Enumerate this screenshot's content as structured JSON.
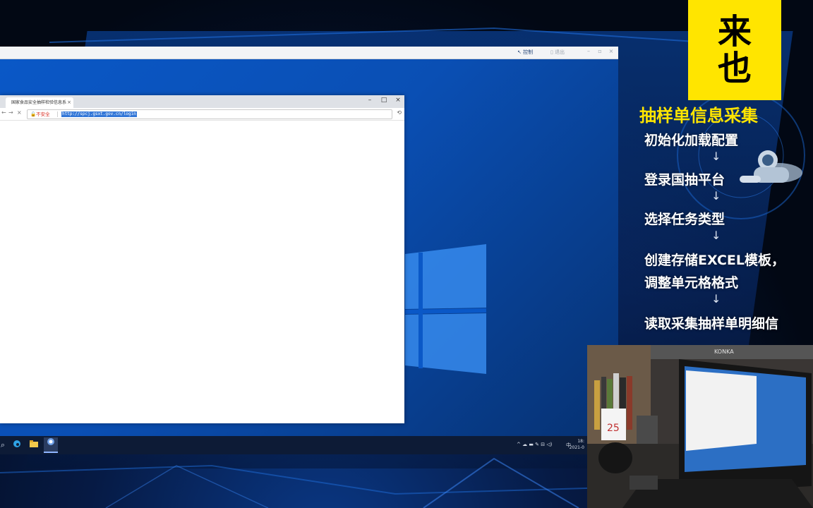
{
  "remote_desktop": {
    "toolbar": {
      "control_label": "控制",
      "exit_label": "退出"
    }
  },
  "browser": {
    "tab_title": "国家食品安全抽样检验信息系",
    "tab_close": "×",
    "window_buttons": [
      "–",
      "□",
      "×"
    ],
    "nav": {
      "back": "←",
      "forward": "→",
      "reload": "×"
    },
    "security_label": "不安全",
    "url": "http://spcj.gsxt.gov.cn/login",
    "history_icon": "⟲"
  },
  "taskbar": {
    "search_icon": "⌕",
    "tray_text": "^ ☁ ▬ ✎ ⊟ ◁)",
    "ime": "中",
    "time": "18:",
    "date": "2021-0"
  },
  "panel": {
    "logo_line1": "来",
    "logo_line2": "也",
    "title": "抽样单信息采集",
    "steps": [
      "初始化加载配置",
      "登录国抽平台",
      "选择任务类型",
      "创建存储EXCEL模板，",
      "调整单元格格式",
      "读取采集抽样单明细信"
    ],
    "arrow": "↓"
  },
  "webcam": {
    "laptop_brand": "KONKA",
    "calendar_day": "25"
  },
  "colors": {
    "accent_yellow": "#ffe500",
    "desktop_blue": "#0a58c7",
    "url_highlight": "#3478d8",
    "insecure_red": "#d93025"
  }
}
